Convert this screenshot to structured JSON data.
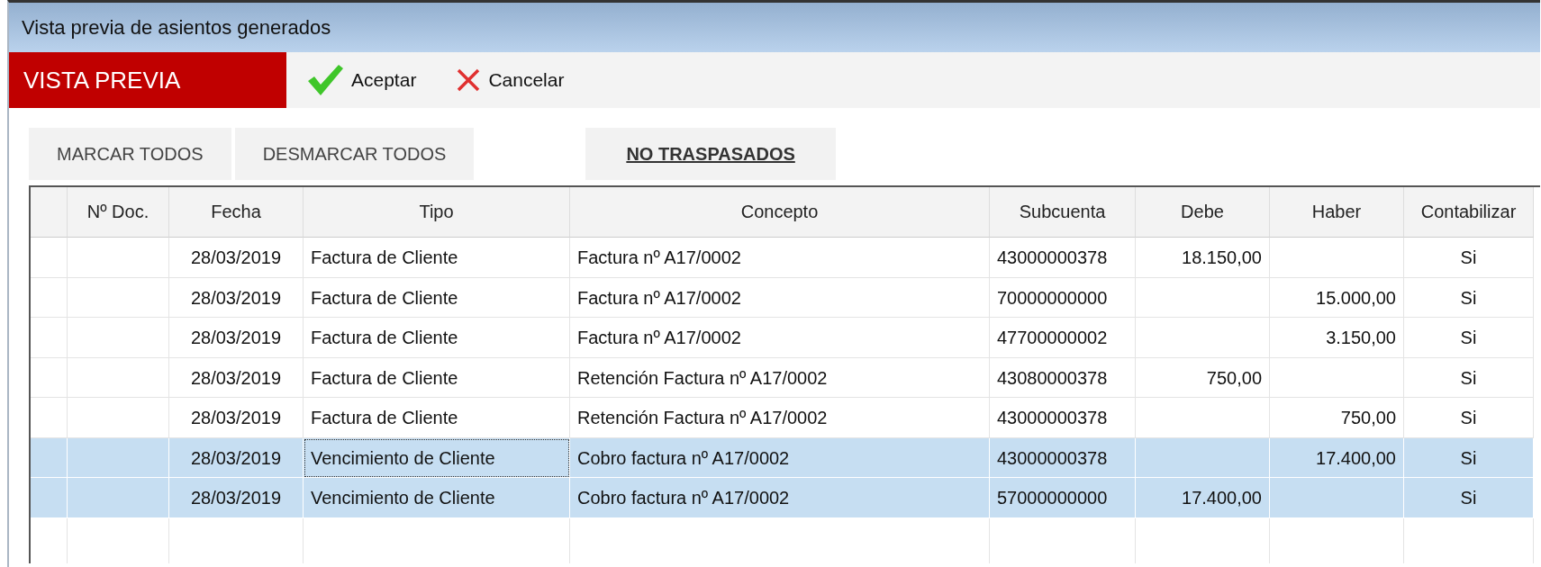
{
  "window": {
    "title": "Vista previa de asientos generados"
  },
  "toolbar": {
    "mode_label": "VISTA PREVIA",
    "buttons": [
      {
        "kind": "accept",
        "label": "Aceptar"
      },
      {
        "kind": "cancel",
        "label": "Cancelar"
      }
    ]
  },
  "actions": [
    {
      "label": "MARCAR TODOS",
      "emphasis": false
    },
    {
      "label": "DESMARCAR TODOS",
      "emphasis": false
    },
    {
      "label": "NO TRASPASADOS",
      "emphasis": true
    }
  ],
  "table": {
    "columns": [
      "Nº Doc.",
      "Fecha",
      "Tipo",
      "Concepto",
      "Subcuenta",
      "Debe",
      "Haber",
      "Contabilizar"
    ],
    "rows": [
      {
        "selected": false,
        "focused": false,
        "cells": [
          "",
          "28/03/2019",
          "Factura de Cliente",
          "Factura nº A17/0002",
          "43000000378",
          "18.150,00",
          "",
          "Si"
        ]
      },
      {
        "selected": false,
        "focused": false,
        "cells": [
          "",
          "28/03/2019",
          "Factura de Cliente",
          "Factura nº A17/0002",
          "70000000000",
          "",
          "15.000,00",
          "Si"
        ]
      },
      {
        "selected": false,
        "focused": false,
        "cells": [
          "",
          "28/03/2019",
          "Factura de Cliente",
          "Factura nº A17/0002",
          "47700000002",
          "",
          "3.150,00",
          "Si"
        ]
      },
      {
        "selected": false,
        "focused": false,
        "cells": [
          "",
          "28/03/2019",
          "Factura de Cliente",
          "Retención Factura nº A17/0002",
          "43080000378",
          "750,00",
          "",
          "Si"
        ]
      },
      {
        "selected": false,
        "focused": false,
        "cells": [
          "",
          "28/03/2019",
          "Factura de Cliente",
          "Retención Factura nº A17/0002",
          "43000000378",
          "",
          "750,00",
          "Si"
        ]
      },
      {
        "selected": true,
        "focused": true,
        "cells": [
          "",
          "28/03/2019",
          "Vencimiento de Cliente",
          "Cobro factura nº A17/0002",
          "43000000378",
          "",
          "17.400,00",
          "Si"
        ]
      },
      {
        "selected": true,
        "focused": false,
        "cells": [
          "",
          "28/03/2019",
          "Vencimiento de Cliente",
          "Cobro factura nº A17/0002",
          "57000000000",
          "17.400,00",
          "",
          "Si"
        ]
      }
    ]
  }
}
